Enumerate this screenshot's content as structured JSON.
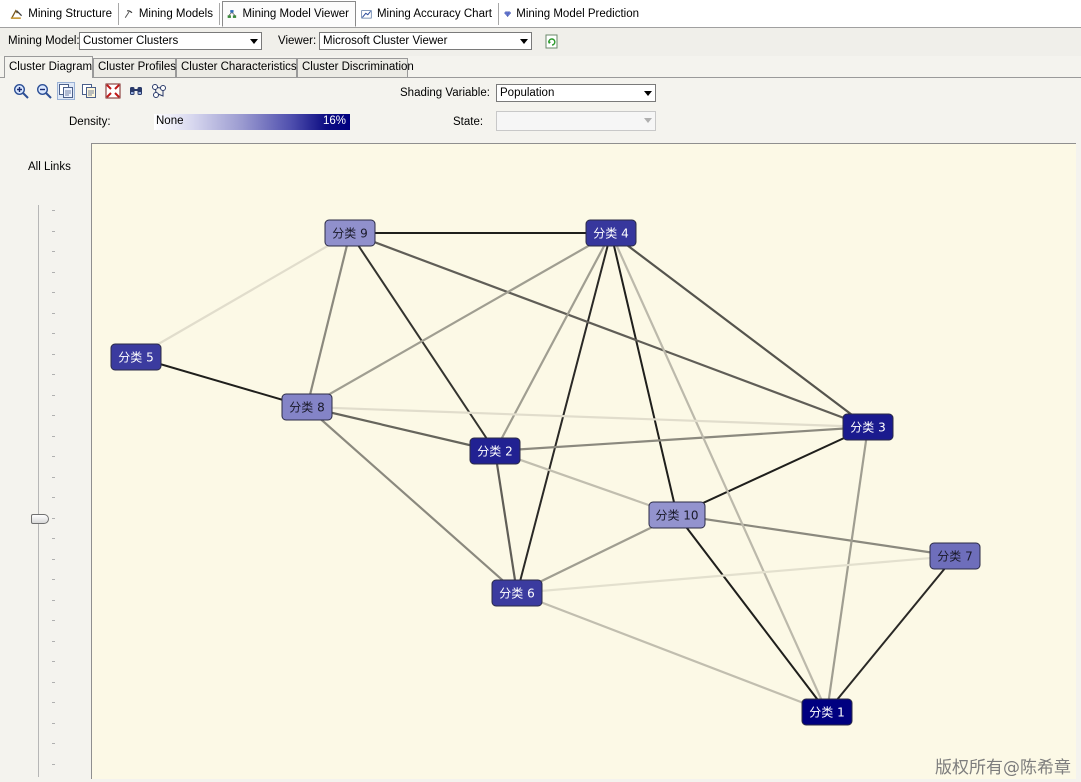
{
  "top_tabs": [
    {
      "label": "Mining Structure",
      "icon": "mining-structure-icon"
    },
    {
      "label": "Mining Models",
      "icon": "mining-models-icon"
    },
    {
      "label": "Mining Model Viewer",
      "icon": "mining-model-viewer-icon",
      "active": true
    },
    {
      "label": "Mining Accuracy Chart",
      "icon": "accuracy-chart-icon"
    },
    {
      "label": "Mining Model Prediction",
      "icon": "prediction-icon"
    }
  ],
  "model_row": {
    "mining_model_label": "Mining Model:",
    "mining_model_value": "Customer Clusters",
    "viewer_label": "Viewer:",
    "viewer_value": "Microsoft Cluster Viewer"
  },
  "sub_tabs": [
    {
      "label": "Cluster Diagram",
      "active": true
    },
    {
      "label": "Cluster Profiles"
    },
    {
      "label": "Cluster Characteristics"
    },
    {
      "label": "Cluster Discrimination"
    }
  ],
  "toolbar": {
    "icons": [
      "zoom-in-icon",
      "zoom-out-icon",
      "copy-graph-view-icon",
      "copy-entire-graph-icon",
      "fit-to-window-icon",
      "find-node-icon",
      "layout-icon"
    ]
  },
  "shading": {
    "label": "Shading Variable:",
    "value": "Population",
    "state_label": "State:",
    "state_value": ""
  },
  "density": {
    "label": "Density:",
    "min_label": "None",
    "max_label": "16%"
  },
  "links_slider": {
    "label": "All Links"
  },
  "diagram": {
    "colors": {
      "background": "#fcf9e6",
      "darkest_node": "#000080",
      "light_node": "#a9a8d8"
    },
    "nodes": [
      {
        "id": "c1",
        "label": "分类 1",
        "shade": 1.0
      },
      {
        "id": "c2",
        "label": "分类 2",
        "shade": 0.82
      },
      {
        "id": "c3",
        "label": "分类 3",
        "shade": 0.86
      },
      {
        "id": "c4",
        "label": "分类 4",
        "shade": 0.7
      },
      {
        "id": "c5",
        "label": "分类 5",
        "shade": 0.68
      },
      {
        "id": "c6",
        "label": "分类 6",
        "shade": 0.68
      },
      {
        "id": "c7",
        "label": "分类 7",
        "shade": 0.4
      },
      {
        "id": "c8",
        "label": "分类 8",
        "shade": 0.28
      },
      {
        "id": "c9",
        "label": "分类 9",
        "shade": 0.22
      },
      {
        "id": "c10",
        "label": "分类 10",
        "shade": 0.2
      }
    ],
    "links": [
      {
        "from": "c9",
        "to": "c4",
        "strength": 0.95
      },
      {
        "from": "c5",
        "to": "c8",
        "strength": 0.95
      },
      {
        "from": "c9",
        "to": "c2",
        "strength": 0.85
      },
      {
        "from": "c4",
        "to": "c6",
        "strength": 0.9
      },
      {
        "from": "c4",
        "to": "c10",
        "strength": 0.95
      },
      {
        "from": "c10",
        "to": "c3",
        "strength": 0.95
      },
      {
        "from": "c10",
        "to": "c1",
        "strength": 0.95
      },
      {
        "from": "c7",
        "to": "c1",
        "strength": 0.9
      },
      {
        "from": "c4",
        "to": "c3",
        "strength": 0.7
      },
      {
        "from": "c9",
        "to": "c3",
        "strength": 0.65
      },
      {
        "from": "c8",
        "to": "c2",
        "strength": 0.62
      },
      {
        "from": "c2",
        "to": "c6",
        "strength": 0.65
      },
      {
        "from": "c9",
        "to": "c8",
        "strength": 0.45
      },
      {
        "from": "c8",
        "to": "c4",
        "strength": 0.35
      },
      {
        "from": "c4",
        "to": "c2",
        "strength": 0.35
      },
      {
        "from": "c8",
        "to": "c6",
        "strength": 0.45
      },
      {
        "from": "c2",
        "to": "c3",
        "strength": 0.45
      },
      {
        "from": "c10",
        "to": "c7",
        "strength": 0.45
      },
      {
        "from": "c6",
        "to": "c10",
        "strength": 0.35
      },
      {
        "from": "c3",
        "to": "c1",
        "strength": 0.35
      },
      {
        "from": "c4",
        "to": "c1",
        "strength": 0.22
      },
      {
        "from": "c2",
        "to": "c10",
        "strength": 0.2
      },
      {
        "from": "c6",
        "to": "c1",
        "strength": 0.2
      },
      {
        "from": "c9",
        "to": "c5",
        "strength": 0.05
      },
      {
        "from": "c8",
        "to": "c3",
        "strength": 0.05
      },
      {
        "from": "c6",
        "to": "c7",
        "strength": 0.04
      }
    ]
  },
  "watermark": "版权所有@陈希章"
}
